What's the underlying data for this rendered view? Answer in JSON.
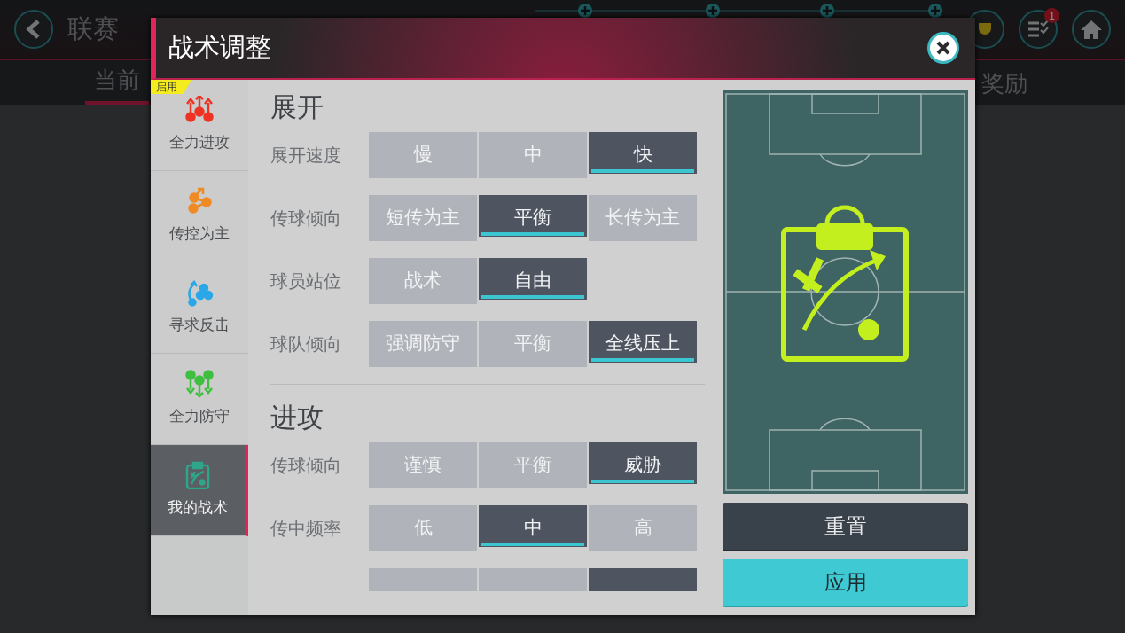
{
  "background": {
    "title": "联赛",
    "tabs": [
      {
        "label": "当前",
        "selected": true
      },
      {
        "label": "奖励",
        "selected": false
      }
    ],
    "badge": "1"
  },
  "dialog": {
    "title": "战术调整",
    "presets": [
      {
        "label": "全力进攻",
        "kind": "attack",
        "color": "#ee3324",
        "selected": false,
        "tag": "启用"
      },
      {
        "label": "传控为主",
        "kind": "possession",
        "color": "#f08a24",
        "selected": false
      },
      {
        "label": "寻求反击",
        "kind": "counter",
        "color": "#2aa7e6",
        "selected": false
      },
      {
        "label": "全力防守",
        "kind": "defend",
        "color": "#3fbf3f",
        "selected": false
      },
      {
        "label": "我的战术",
        "kind": "custom",
        "color": "#2fa58a",
        "selected": true
      }
    ],
    "sections": [
      {
        "title": "展开",
        "rows": [
          {
            "label": "展开速度",
            "options": [
              {
                "label": "慢",
                "selected": false
              },
              {
                "label": "中",
                "selected": false
              },
              {
                "label": "快",
                "selected": true
              }
            ]
          },
          {
            "label": "传球倾向",
            "options": [
              {
                "label": "短传为主",
                "selected": false
              },
              {
                "label": "平衡",
                "selected": true
              },
              {
                "label": "长传为主",
                "selected": false
              }
            ]
          },
          {
            "label": "球员站位",
            "options": [
              {
                "label": "战术",
                "selected": false
              },
              {
                "label": "自由",
                "selected": true
              }
            ]
          },
          {
            "label": "球队倾向",
            "options": [
              {
                "label": "强调防守",
                "selected": false
              },
              {
                "label": "平衡",
                "selected": false
              },
              {
                "label": "全线压上",
                "selected": true
              }
            ]
          }
        ]
      },
      {
        "title": "进攻",
        "rows": [
          {
            "label": "传球倾向",
            "options": [
              {
                "label": "谨慎",
                "selected": false
              },
              {
                "label": "平衡",
                "selected": false
              },
              {
                "label": "威胁",
                "selected": true
              }
            ]
          },
          {
            "label": "传中频率",
            "options": [
              {
                "label": "低",
                "selected": false
              },
              {
                "label": "中",
                "selected": true
              },
              {
                "label": "高",
                "selected": false
              }
            ]
          },
          {
            "options": [
              {
                "selected": false
              },
              {
                "selected": false
              },
              {
                "selected": true
              }
            ]
          }
        ]
      }
    ],
    "buttons": [
      {
        "label": "重置",
        "kind": "secondary"
      },
      {
        "label": "应用",
        "kind": "primary"
      }
    ]
  }
}
